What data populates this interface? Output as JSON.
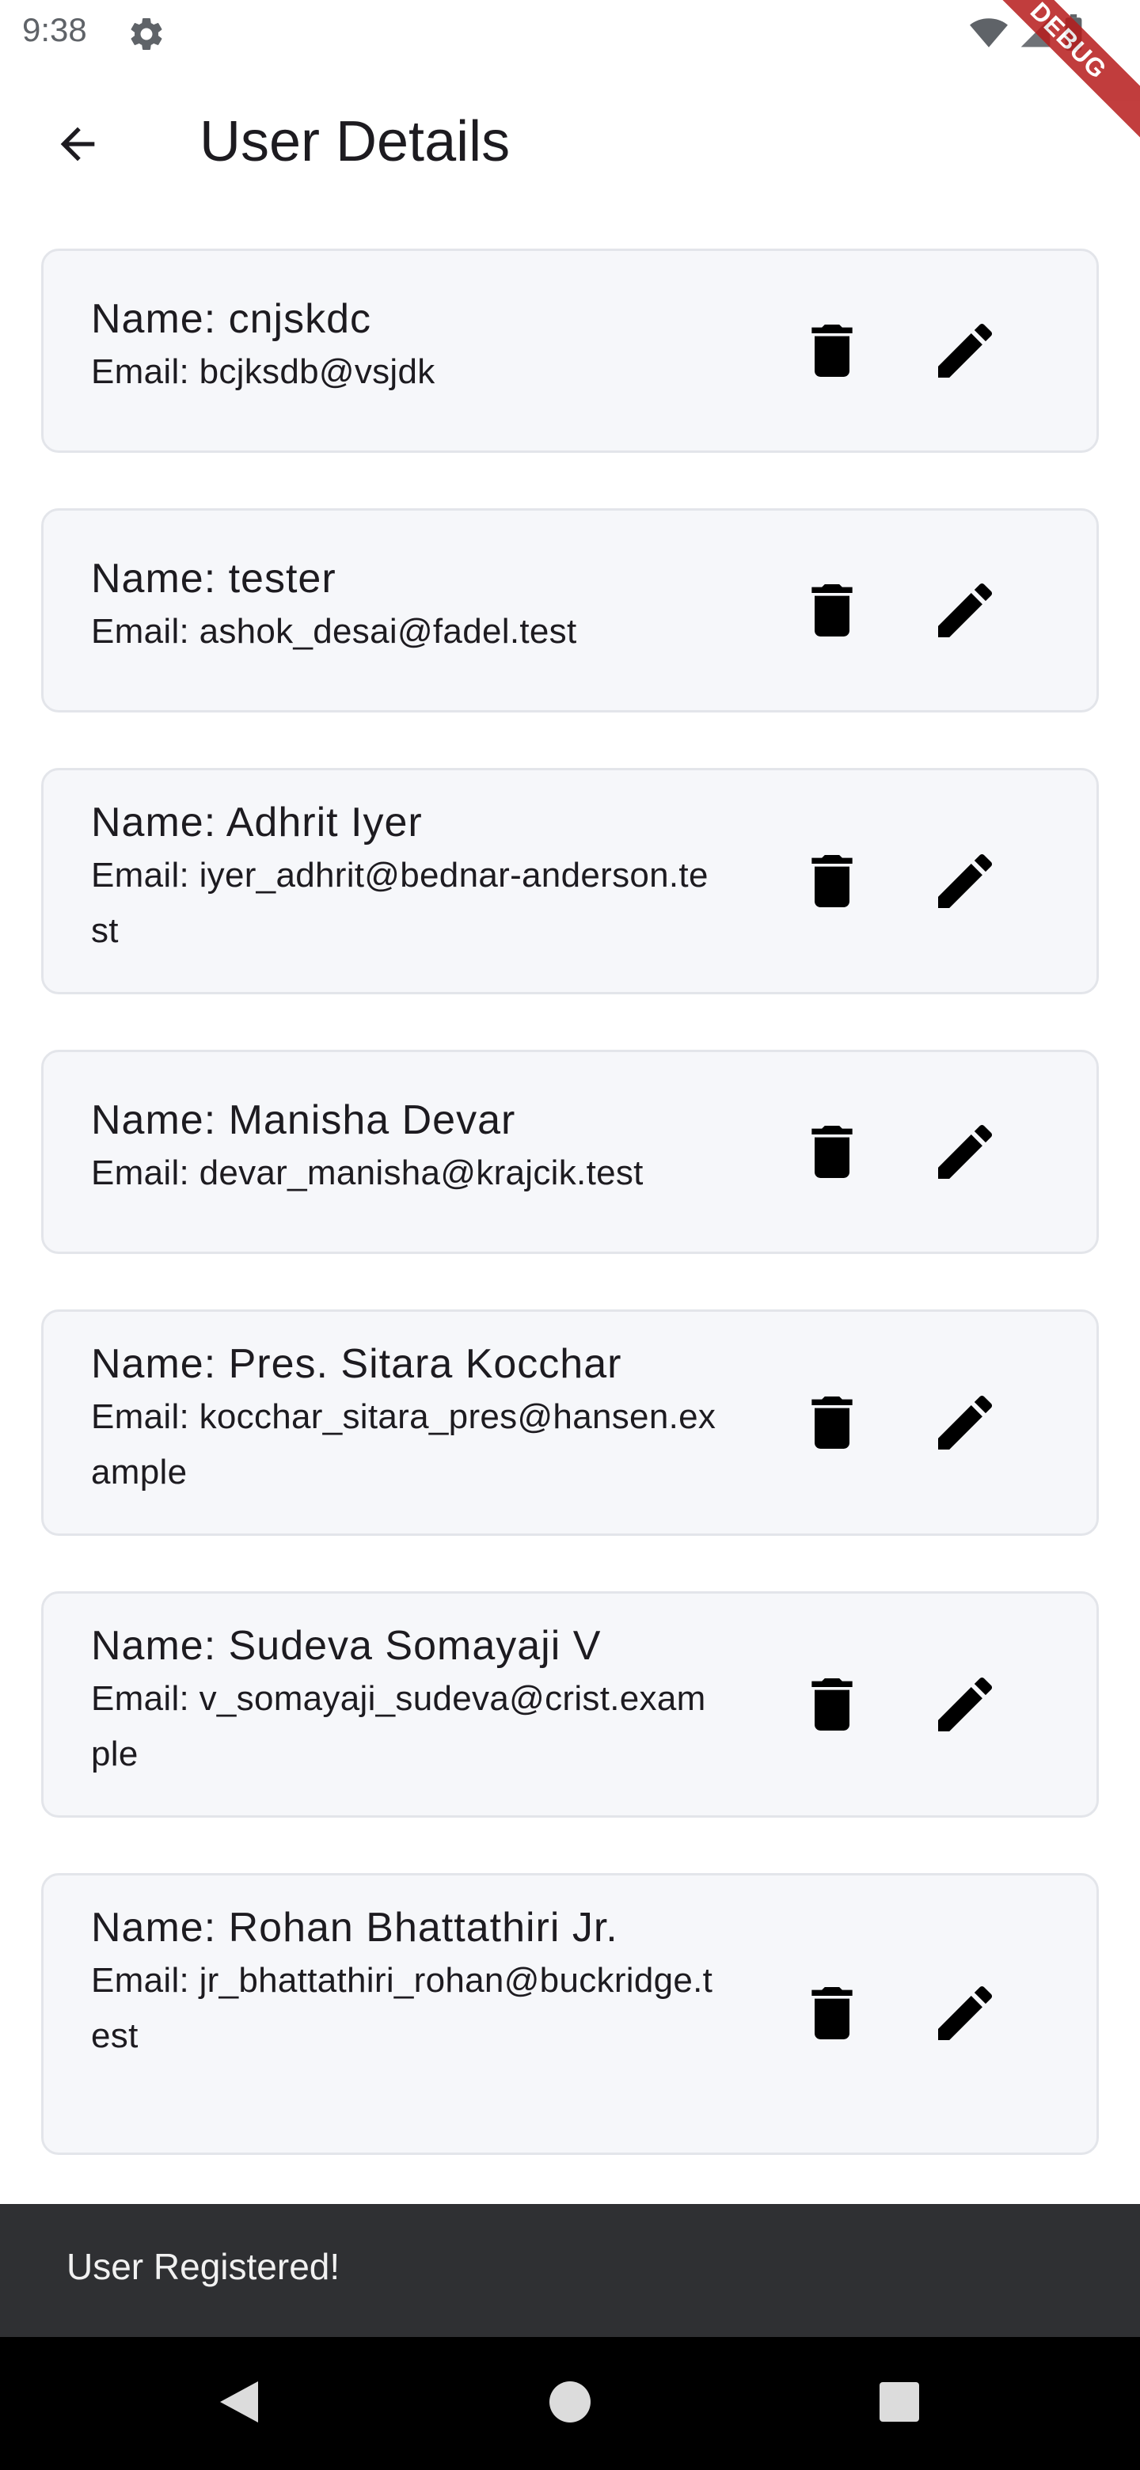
{
  "status_bar": {
    "time": "9:38",
    "debug_label": "DEBUG"
  },
  "app_bar": {
    "title": "User Details"
  },
  "users": [
    {
      "name": "Name: cnjskdc",
      "email": "Email: bcjksdb@vsjdk"
    },
    {
      "name": "Name: tester",
      "email": "Email: ashok_desai@fadel.test"
    },
    {
      "name": "Name: Adhrit Iyer",
      "email": "Email: iyer_adhrit@bednar-anderson.test"
    },
    {
      "name": "Name: Manisha Devar",
      "email": "Email: devar_manisha@krajcik.test"
    },
    {
      "name": "Name: Pres. Sitara Kocchar",
      "email": "Email: kocchar_sitara_pres@hansen.example"
    },
    {
      "name": "Name: Sudeva Somayaji V",
      "email": "Email: v_somayaji_sudeva@crist.example"
    },
    {
      "name": "Name: Rohan Bhattathiri Jr.",
      "email": "Email: jr_bhattathiri_rohan@buckridge.test"
    }
  ],
  "snackbar": {
    "message": "User Registered!"
  },
  "icons": {
    "back": "arrow-back-icon",
    "delete": "trash-icon",
    "edit": "pencil-icon",
    "settings": "gear-icon",
    "wifi": "wifi-icon",
    "signal": "signal-icon",
    "battery": "battery-icon"
  },
  "colors": {
    "card_background": "#f6f7fa",
    "card_border": "#e3e5ea",
    "snackbar_background": "#2f3033",
    "debug_banner": "#b71c1c"
  }
}
